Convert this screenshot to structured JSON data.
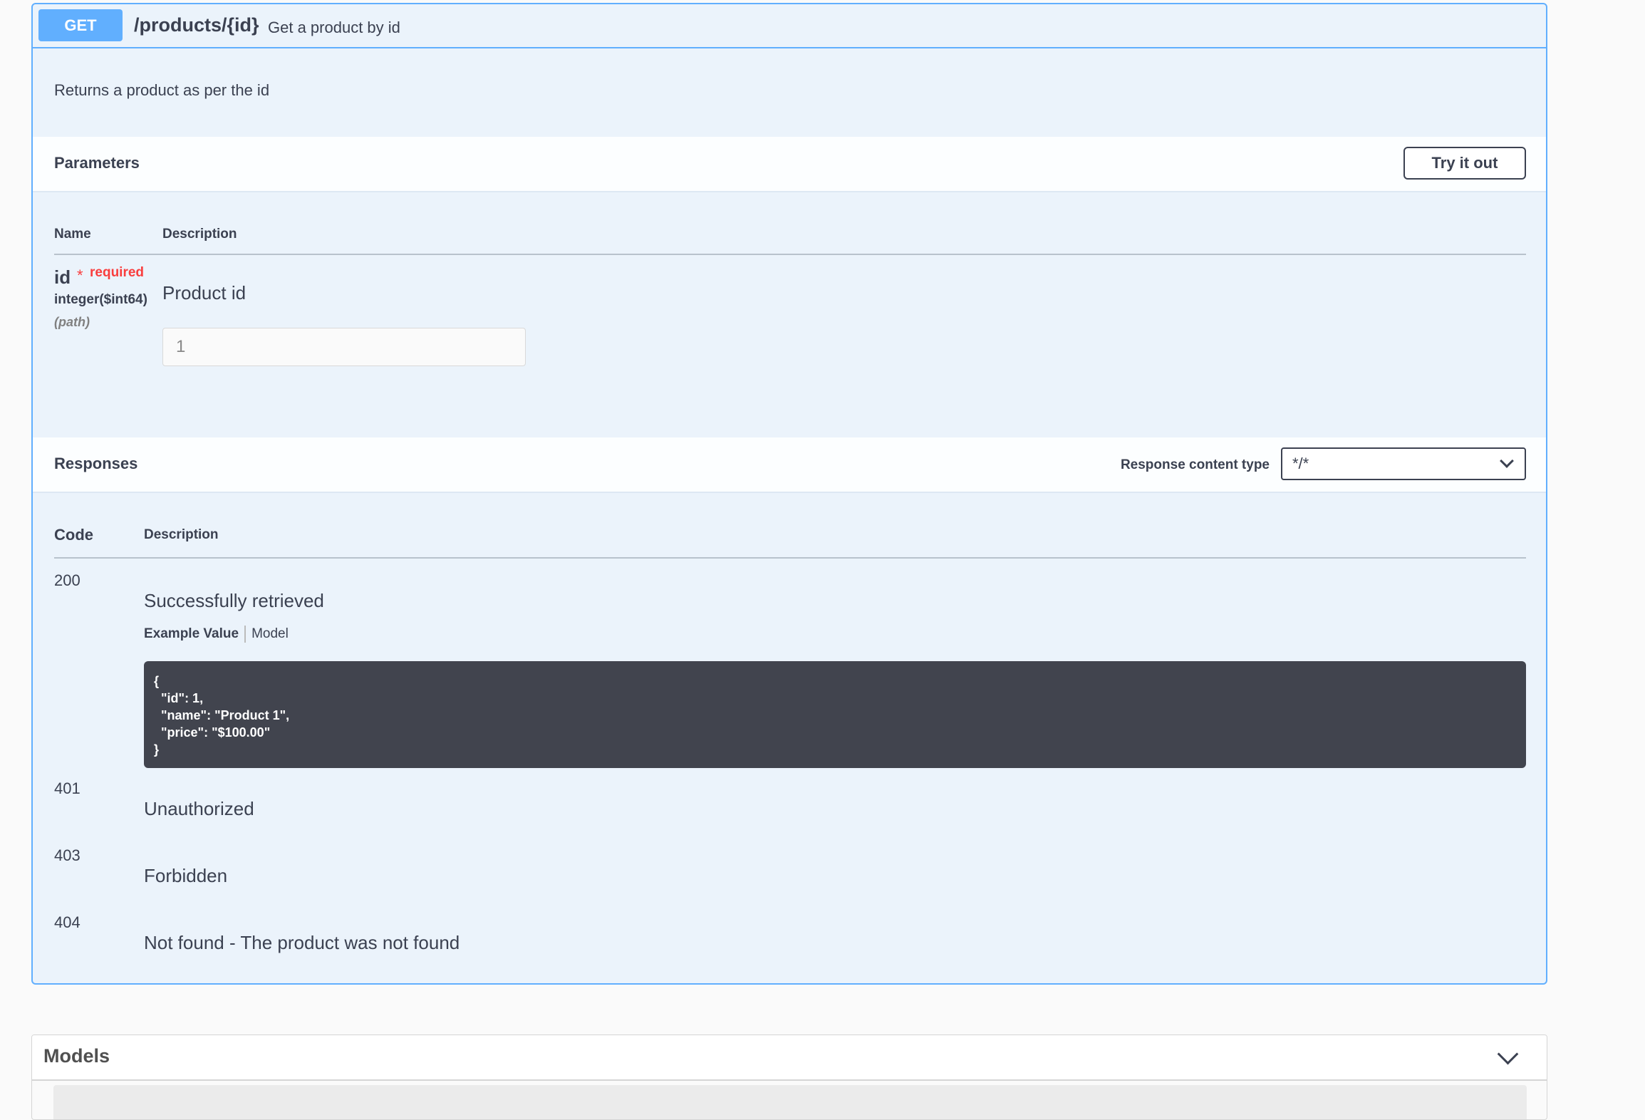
{
  "operation": {
    "method": "GET",
    "path": "/products/{id}",
    "summary": "Get a product by id",
    "description": "Returns a product as per the id"
  },
  "parameters": {
    "title": "Parameters",
    "try_label": "Try it out",
    "col_name": "Name",
    "col_description": "Description",
    "items": [
      {
        "name": "id",
        "star": "*",
        "required": "required",
        "type": "integer($int64)",
        "in": "(path)",
        "description": "Product id",
        "value": "1"
      }
    ]
  },
  "responses": {
    "title": "Responses",
    "content_type_label": "Response content type",
    "content_type_value": "*/*",
    "col_code": "Code",
    "col_description": "Description",
    "items": [
      {
        "code": "200",
        "description": "Successfully retrieved"
      },
      {
        "code": "401",
        "description": "Unauthorized"
      },
      {
        "code": "403",
        "description": "Forbidden"
      },
      {
        "code": "404",
        "description": "Not found - The product was not found"
      }
    ],
    "example_tab": "Example Value",
    "model_tab": "Model",
    "example_json": "{\n  \"id\": 1,\n  \"name\": \"Product 1\",\n  \"price\": \"$100.00\"\n}"
  },
  "models": {
    "title": "Models"
  },
  "colors": {
    "get": "#61affe",
    "required": "#f93e3e",
    "code_bg": "#41444e"
  }
}
